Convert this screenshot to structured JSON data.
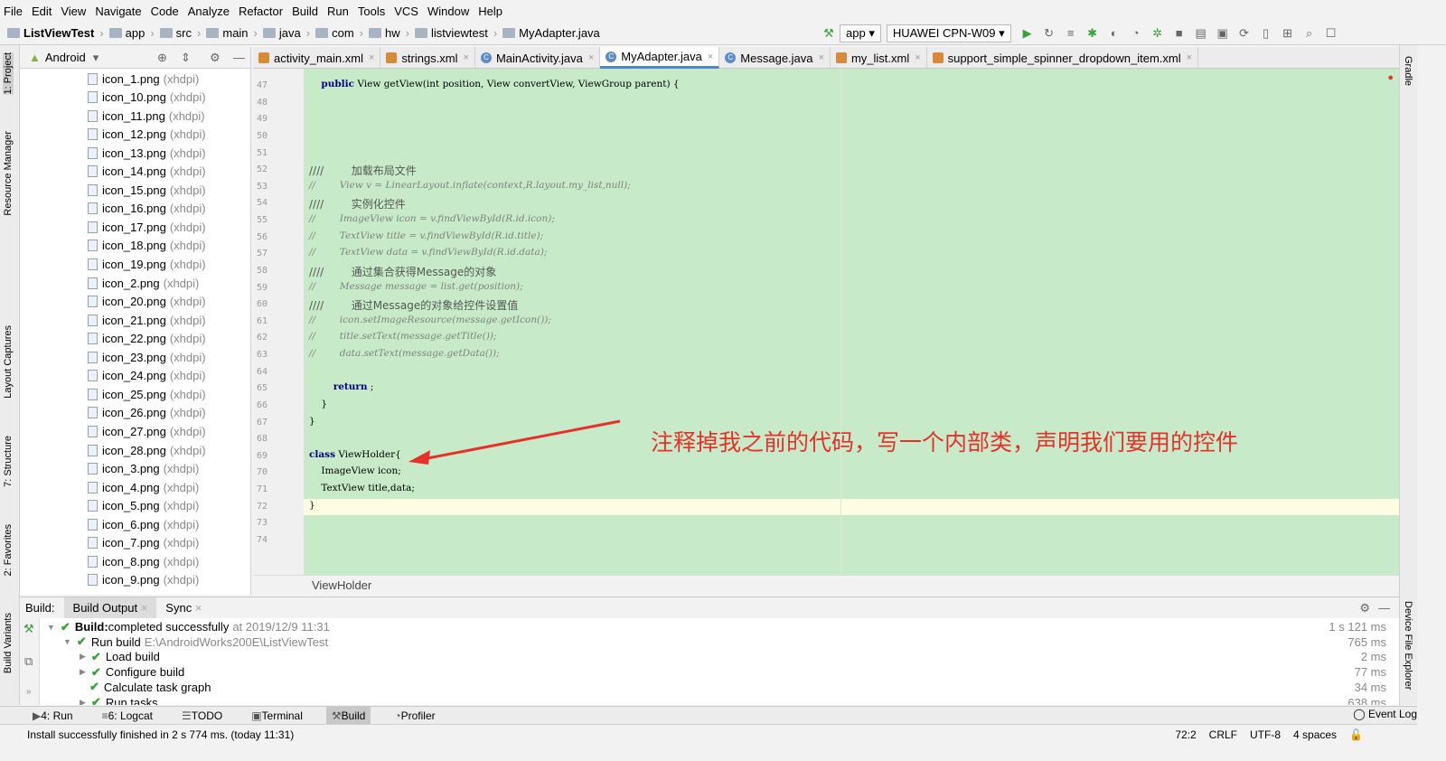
{
  "menu": [
    "File",
    "Edit",
    "View",
    "Navigate",
    "Code",
    "Analyze",
    "Refactor",
    "Build",
    "Run",
    "Tools",
    "VCS",
    "Window",
    "Help"
  ],
  "breadcrumbs": [
    "ListViewTest",
    "app",
    "src",
    "main",
    "java",
    "com",
    "hw",
    "listviewtest",
    "MyAdapter.java"
  ],
  "toolbar": {
    "config": "app",
    "device": "HUAWEI CPN-W09"
  },
  "project": {
    "view": "Android",
    "items": [
      {
        "name": "icon_1.png",
        "q": "(xhdpi)"
      },
      {
        "name": "icon_10.png",
        "q": "(xhdpi)"
      },
      {
        "name": "icon_11.png",
        "q": "(xhdpi)"
      },
      {
        "name": "icon_12.png",
        "q": "(xhdpi)"
      },
      {
        "name": "icon_13.png",
        "q": "(xhdpi)"
      },
      {
        "name": "icon_14.png",
        "q": "(xhdpi)"
      },
      {
        "name": "icon_15.png",
        "q": "(xhdpi)"
      },
      {
        "name": "icon_16.png",
        "q": "(xhdpi)"
      },
      {
        "name": "icon_17.png",
        "q": "(xhdpi)"
      },
      {
        "name": "icon_18.png",
        "q": "(xhdpi)"
      },
      {
        "name": "icon_19.png",
        "q": "(xhdpi)"
      },
      {
        "name": "icon_2.png",
        "q": "(xhdpi)"
      },
      {
        "name": "icon_20.png",
        "q": "(xhdpi)"
      },
      {
        "name": "icon_21.png",
        "q": "(xhdpi)"
      },
      {
        "name": "icon_22.png",
        "q": "(xhdpi)"
      },
      {
        "name": "icon_23.png",
        "q": "(xhdpi)"
      },
      {
        "name": "icon_24.png",
        "q": "(xhdpi)"
      },
      {
        "name": "icon_25.png",
        "q": "(xhdpi)"
      },
      {
        "name": "icon_26.png",
        "q": "(xhdpi)"
      },
      {
        "name": "icon_27.png",
        "q": "(xhdpi)"
      },
      {
        "name": "icon_28.png",
        "q": "(xhdpi)"
      },
      {
        "name": "icon_3.png",
        "q": "(xhdpi)"
      },
      {
        "name": "icon_4.png",
        "q": "(xhdpi)"
      },
      {
        "name": "icon_5.png",
        "q": "(xhdpi)"
      },
      {
        "name": "icon_6.png",
        "q": "(xhdpi)"
      },
      {
        "name": "icon_7.png",
        "q": "(xhdpi)"
      },
      {
        "name": "icon_8.png",
        "q": "(xhdpi)"
      },
      {
        "name": "icon_9.png",
        "q": "(xhdpi)"
      }
    ]
  },
  "tabs": [
    {
      "label": "activity_main.xml",
      "type": "xml"
    },
    {
      "label": "strings.xml",
      "type": "xml"
    },
    {
      "label": "MainActivity.java",
      "type": "java"
    },
    {
      "label": "MyAdapter.java",
      "type": "java",
      "active": true
    },
    {
      "label": "Message.java",
      "type": "java"
    },
    {
      "label": "my_list.xml",
      "type": "xml"
    },
    {
      "label": "support_simple_spinner_dropdown_item.xml",
      "type": "xml"
    }
  ],
  "code": [
    {
      "n": "47",
      "t": "    public View getView(int position, View convertView, ViewGroup parent) {",
      "k": "kw"
    },
    {
      "n": "48",
      "t": ""
    },
    {
      "n": "49",
      "t": ""
    },
    {
      "n": "50",
      "t": ""
    },
    {
      "n": "51",
      "t": ""
    },
    {
      "n": "52",
      "t": "////        加载布局文件",
      "k": "cmc"
    },
    {
      "n": "53",
      "t": "//        View v = LinearLayout.inflate(context,R.layout.my_list,null);",
      "k": "cm"
    },
    {
      "n": "54",
      "t": "////        实例化控件",
      "k": "cmc"
    },
    {
      "n": "55",
      "t": "//        ImageView icon = v.findViewById(R.id.icon);",
      "k": "cm"
    },
    {
      "n": "56",
      "t": "//        TextView title = v.findViewById(R.id.title);",
      "k": "cm"
    },
    {
      "n": "57",
      "t": "//        TextView data = v.findViewById(R.id.data);",
      "k": "cm"
    },
    {
      "n": "58",
      "t": "////        通过集合获得Message的对象",
      "k": "cmc"
    },
    {
      "n": "59",
      "t": "//        Message message = list.get(position);",
      "k": "cm"
    },
    {
      "n": "60",
      "t": "////        通过Message的对象给控件设置值",
      "k": "cmc"
    },
    {
      "n": "61",
      "t": "//        icon.setImageResource(message.getIcon());",
      "k": "cm"
    },
    {
      "n": "62",
      "t": "//        title.setText(message.getTitle());",
      "k": "cm"
    },
    {
      "n": "63",
      "t": "//        data.setText(message.getData());",
      "k": "cm"
    },
    {
      "n": "64",
      "t": ""
    },
    {
      "n": "65",
      "t": "        return ;",
      "k": "kw"
    },
    {
      "n": "66",
      "t": "    }"
    },
    {
      "n": "67",
      "t": "}"
    },
    {
      "n": "68",
      "t": ""
    },
    {
      "n": "69",
      "t": "class ViewHolder{",
      "k": "kw"
    },
    {
      "n": "70",
      "t": "    ImageView icon;"
    },
    {
      "n": "71",
      "t": "    TextView title,data;"
    },
    {
      "n": "72",
      "t": "}"
    },
    {
      "n": "73",
      "t": ""
    },
    {
      "n": "74",
      "t": ""
    }
  ],
  "annotation": "注释掉我之前的代码，写一个内部类，声明我们要用的控件",
  "editor_breadcrumb": "ViewHolder",
  "left_tools": [
    "1: Project",
    "Resource Manager",
    "Layout Captures",
    "7: Structure",
    "2: Favorites",
    "Build Variants"
  ],
  "right_tools": [
    "Gradle",
    "Device File Explorer"
  ],
  "build": {
    "label": "Build:",
    "tabs": [
      "Build Output",
      "Sync"
    ],
    "rows": [
      {
        "label": "Build:",
        "rest": " completed successfully",
        "grey": "at 2019/12/9 11:31",
        "dur": "1 s 121 ms",
        "indent": 0,
        "tri": "▼"
      },
      {
        "label": "",
        "rest": "Run build",
        "grey": "E:\\AndroidWorks200E\\ListViewTest",
        "dur": "765 ms",
        "indent": 1,
        "tri": "▼"
      },
      {
        "label": "",
        "rest": "Load build",
        "grey": "",
        "dur": "2 ms",
        "indent": 2,
        "tri": "▶"
      },
      {
        "label": "",
        "rest": "Configure build",
        "grey": "",
        "dur": "77 ms",
        "indent": 2,
        "tri": "▶"
      },
      {
        "label": "",
        "rest": "Calculate task graph",
        "grey": "",
        "dur": "34 ms",
        "indent": 2,
        "tri": ""
      },
      {
        "label": "",
        "rest": "Run tasks",
        "grey": "",
        "dur": "638 ms",
        "indent": 2,
        "tri": "▶"
      }
    ]
  },
  "tool_tabs": [
    "4: Run",
    "6: Logcat",
    "TODO",
    "Terminal",
    "Build",
    "Profiler"
  ],
  "event_log": "Event Log",
  "status": {
    "message": "Install successfully finished in 2 s 774 ms. (today 11:31)",
    "position": "72:2",
    "line_sep": "CRLF",
    "encoding": "UTF-8",
    "indent": "4 spaces"
  }
}
